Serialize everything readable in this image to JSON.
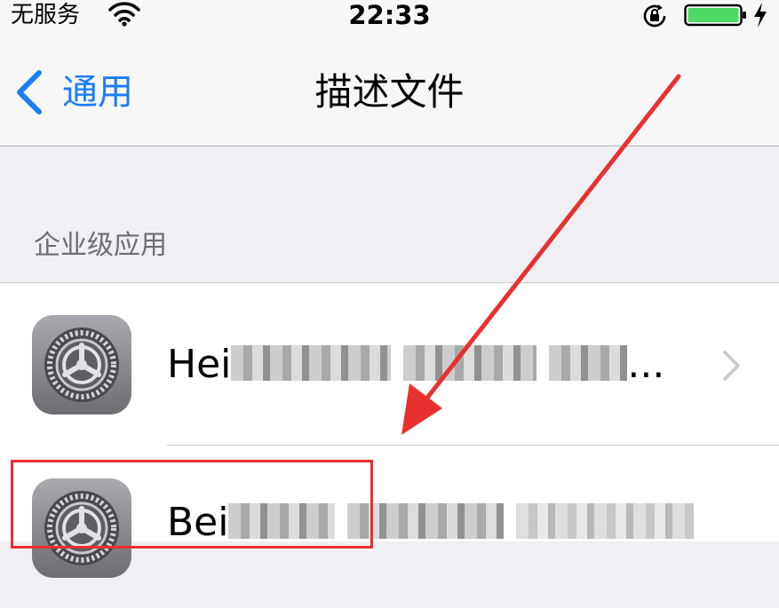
{
  "status_bar": {
    "carrier": "无服务",
    "time": "22:33"
  },
  "nav": {
    "back_label": "通用",
    "title": "描述文件"
  },
  "section": {
    "header": "企业级应用"
  },
  "profiles": [
    {
      "label_visible": "Hei",
      "label_suffix": ".",
      "icon": "settings-gear-icon",
      "has_chevron": true
    },
    {
      "label_visible": "Bei",
      "icon": "settings-gear-icon",
      "has_chevron": false
    }
  ],
  "colors": {
    "accent": "#1a7cf7",
    "annotation": "#e8312f",
    "battery": "#4cd964",
    "background": "#efeff4"
  }
}
